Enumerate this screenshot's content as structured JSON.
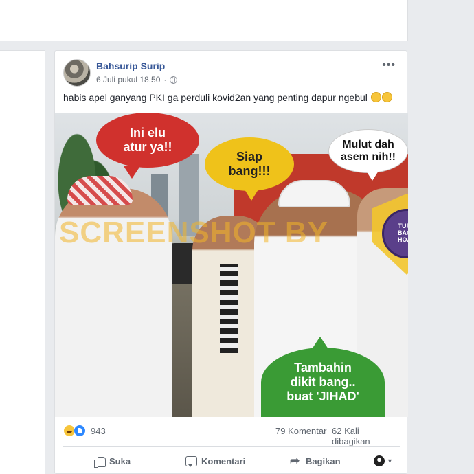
{
  "post": {
    "author": "Bahsurip Surip",
    "timestamp": "6 Juli pukul 18.50",
    "privacy_icon": "globe-icon",
    "more_icon": "ellipsis-icon",
    "caption": "habis apel ganyang PKI ga perduli kovid2an yang penting dapur ngebul",
    "caption_emoji": [
      "grin-emoji",
      "grin-emoji"
    ]
  },
  "image": {
    "bubbles": {
      "red": [
        "Ini elu",
        "atur ya!!"
      ],
      "yellow": [
        "Siap",
        "bang!!!"
      ],
      "white": [
        "Mulut dah",
        "asem nih!!"
      ],
      "green": [
        "Tambahin",
        "dikit bang..",
        "buat 'JIHAD'"
      ]
    },
    "watermark": "SCREENSHOT BY",
    "badge_lines": [
      "TURN",
      "BACK",
      "HOAX"
    ]
  },
  "stats": {
    "reactions_count": "943",
    "reaction_icons": [
      "haha-icon",
      "like-icon"
    ],
    "comments": "79 Komentar",
    "shares": "62 Kali dibagikan"
  },
  "actions": {
    "like": "Suka",
    "comment": "Komentari",
    "share": "Bagikan"
  },
  "colors": {
    "link": "#385898",
    "bubble_red": "#d0312d",
    "bubble_yellow": "#efc21a",
    "bubble_green": "#3a9b35",
    "page_bg": "#e9ebee"
  }
}
